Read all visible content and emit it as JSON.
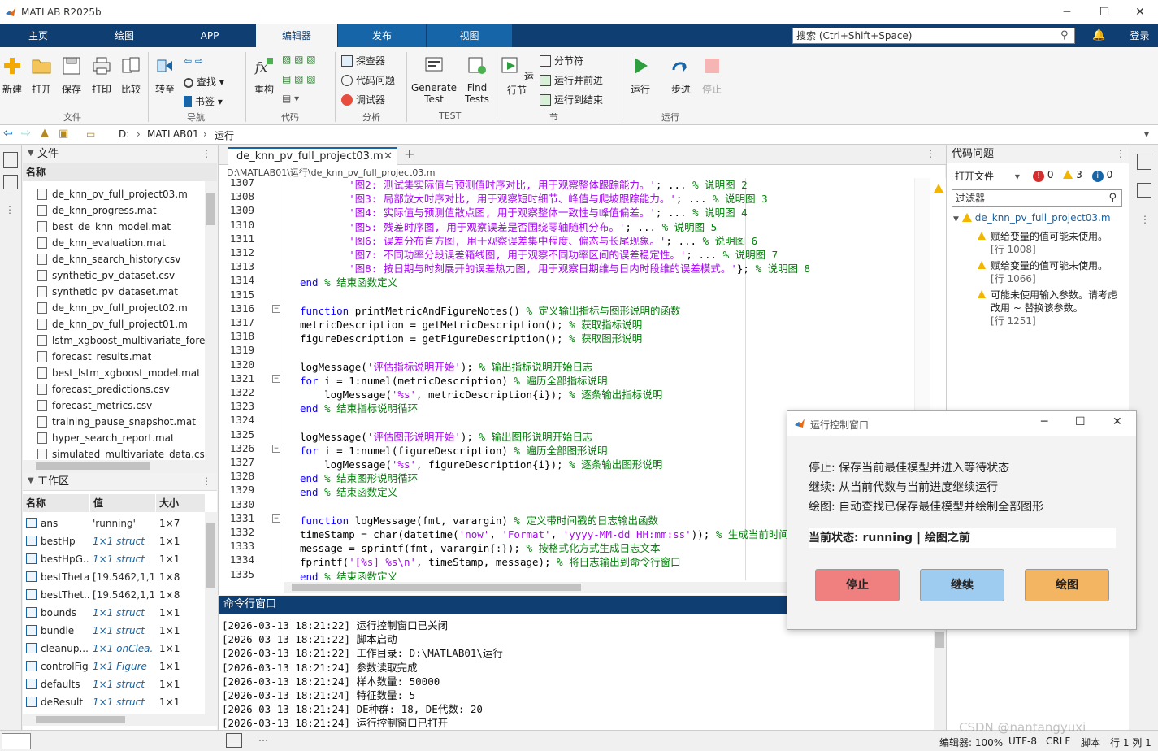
{
  "window": {
    "title": "MATLAB R2025b"
  },
  "tabs": [
    "主页",
    "绘图",
    "APP",
    "编辑器",
    "发布",
    "视图"
  ],
  "search": {
    "placeholder": "搜索 (Ctrl+Shift+Space)"
  },
  "login": "登录",
  "ribbon": {
    "file": {
      "new": "新建",
      "open": "打开",
      "save": "保存",
      "print": "打印",
      "compare": "比较",
      "group": "文件"
    },
    "nav": {
      "goto": "转至",
      "find": "查找",
      "bookmark": "书签",
      "group": "导航"
    },
    "code": {
      "refactor": "重构",
      "group": "代码"
    },
    "analyze": {
      "explorer": "探查器",
      "issues": "代码问题",
      "debugger": "调试器",
      "group": "分析"
    },
    "test": {
      "generate1": "Generate",
      "generate2": "Test",
      "find1": "Find",
      "find2": "Tests",
      "group": "TEST"
    },
    "section": {
      "runsection": "运行节",
      "sectionbreak": "分节符",
      "runadvance": "运行并前进",
      "runtoend": "运行到结束",
      "group": "节"
    },
    "run": {
      "run": "运行",
      "step": "步进",
      "stop": "停止",
      "group": "运行"
    }
  },
  "address": {
    "parts": [
      "D:",
      "MATLAB01",
      "运行"
    ]
  },
  "files": {
    "title": "文件",
    "col": "名称",
    "items": [
      "de_knn_pv_full_project03.m",
      "de_knn_progress.mat",
      "best_de_knn_model.mat",
      "de_knn_evaluation.mat",
      "de_knn_search_history.csv",
      "synthetic_pv_dataset.csv",
      "synthetic_pv_dataset.mat",
      "de_knn_pv_full_project02.m",
      "de_knn_pv_full_project01.m",
      "lstm_xgboost_multivariate_forecast",
      "forecast_results.mat",
      "best_lstm_xgboost_model.mat",
      "forecast_predictions.csv",
      "forecast_metrics.csv",
      "training_pause_snapshot.mat",
      "hyper_search_report.mat",
      "simulated_multivariate_data.csv"
    ]
  },
  "workspace": {
    "title": "工作区",
    "cols": [
      "名称",
      "值",
      "大小"
    ],
    "rows": [
      [
        "ans",
        "'running'",
        "1×7"
      ],
      [
        "bestHp",
        "1×1 struct",
        "1×1"
      ],
      [
        "bestHpG...",
        "1×1 struct",
        "1×1"
      ],
      [
        "bestTheta",
        "[19.5462,1,1,...",
        "1×8"
      ],
      [
        "bestThet...",
        "[19.5462,1,1,...",
        "1×8"
      ],
      [
        "bounds",
        "1×1 struct",
        "1×1"
      ],
      [
        "bundle",
        "1×1 struct",
        "1×1"
      ],
      [
        "cleanup...",
        "1×1 onClea...",
        "1×1"
      ],
      [
        "controlFig",
        "1×1 Figure",
        "1×1"
      ],
      [
        "defaults",
        "1×1 struct",
        "1×1"
      ],
      [
        "deResult",
        "1×1 struct",
        "1×1"
      ]
    ]
  },
  "editor": {
    "tab": "de_knn_pv_full_project03.m",
    "path": "D:\\MATLAB01\\运行\\de_knn_pv_full_project03.m",
    "lines": [
      {
        "n": "1307",
        "html": "        <span class=\"st\">'图2: 测试集实际值与预测值时序对比, 用于观察整体跟踪能力。'</span>; ... <span class=\"cm\">% 说明图 2</span>"
      },
      {
        "n": "1308",
        "html": "        <span class=\"st\">'图3: 局部放大时序对比, 用于观察短时细节、峰值与爬坡跟踪能力。'</span>; ... <span class=\"cm\">% 说明图 3</span>"
      },
      {
        "n": "1309",
        "html": "        <span class=\"st\">'图4: 实际值与预测值散点图, 用于观察整体一致性与峰值偏差。'</span>; ... <span class=\"cm\">% 说明图 4</span>"
      },
      {
        "n": "1310",
        "html": "        <span class=\"st\">'图5: 残差时序图, 用于观察误差是否围绕零轴随机分布。'</span>; ... <span class=\"cm\">% 说明图 5</span>"
      },
      {
        "n": "1311",
        "html": "        <span class=\"st\">'图6: 误差分布直方图, 用于观察误差集中程度、偏态与长尾现象。'</span>; ... <span class=\"cm\">% 说明图 6</span>"
      },
      {
        "n": "1312",
        "html": "        <span class=\"st\">'图7: 不同功率分段误差箱线图, 用于观察不同功率区间的误差稳定性。'</span>; ... <span class=\"cm\">% 说明图 7</span>"
      },
      {
        "n": "1313",
        "html": "        <span class=\"st\">'图8: 按日期与时刻展开的误差热力图, 用于观察日期维与日内时段维的误差模式。'</span>}; <span class=\"cm\">% 说明图 8</span>"
      },
      {
        "n": "1314",
        "html": "<span class=\"kw\">end</span> <span class=\"cm\">% 结束函数定义</span>"
      },
      {
        "n": "1315",
        "html": ""
      },
      {
        "n": "1316",
        "html": "<span class=\"kw\">function</span> printMetricAndFigureNotes() <span class=\"cm\">% 定义输出指标与图形说明的函数</span>",
        "fold": true
      },
      {
        "n": "1317",
        "html": "metricDescription = getMetricDescription(); <span class=\"cm\">% 获取指标说明</span>"
      },
      {
        "n": "1318",
        "html": "figureDescription = getFigureDescription(); <span class=\"cm\">% 获取图形说明</span>"
      },
      {
        "n": "1319",
        "html": ""
      },
      {
        "n": "1320",
        "html": "logMessage(<span class=\"st\">'评估指标说明开始'</span>); <span class=\"cm\">% 输出指标说明开始日志</span>"
      },
      {
        "n": "1321",
        "html": "<span class=\"kw\">for</span> i = 1:numel(metricDescription) <span class=\"cm\">% 遍历全部指标说明</span>",
        "fold": true
      },
      {
        "n": "1322",
        "html": "    logMessage(<span class=\"st\">'%s'</span>, metricDescription{i}); <span class=\"cm\">% 逐条输出指标说明</span>"
      },
      {
        "n": "1323",
        "html": "<span class=\"kw\">end</span> <span class=\"cm\">% 结束指标说明循环</span>"
      },
      {
        "n": "1324",
        "html": ""
      },
      {
        "n": "1325",
        "html": "logMessage(<span class=\"st\">'评估图形说明开始'</span>); <span class=\"cm\">% 输出图形说明开始日志</span>"
      },
      {
        "n": "1326",
        "html": "<span class=\"kw\">for</span> i = 1:numel(figureDescription) <span class=\"cm\">% 遍历全部图形说明</span>",
        "fold": true
      },
      {
        "n": "1327",
        "html": "    logMessage(<span class=\"st\">'%s'</span>, figureDescription{i}); <span class=\"cm\">% 逐条输出图形说明</span>"
      },
      {
        "n": "1328",
        "html": "<span class=\"kw\">end</span> <span class=\"cm\">% 结束图形说明循环</span>"
      },
      {
        "n": "1329",
        "html": "<span class=\"kw\">end</span> <span class=\"cm\">% 结束函数定义</span>"
      },
      {
        "n": "1330",
        "html": ""
      },
      {
        "n": "1331",
        "html": "<span class=\"kw\">function</span> logMessage(fmt, varargin) <span class=\"cm\">% 定义带时间戳的日志输出函数</span>",
        "fold": true
      },
      {
        "n": "1332",
        "html": "timeStamp = char(datetime(<span class=\"st\">'now'</span>, <span class=\"st\">'Format'</span>, <span class=\"st\">'yyyy-MM-dd HH:mm:ss'</span>)); <span class=\"cm\">% 生成当前时间</span>"
      },
      {
        "n": "1333",
        "html": "message = sprintf(fmt, varargin{:}); <span class=\"cm\">% 按格式化方式生成日志文本</span>"
      },
      {
        "n": "1334",
        "html": "fprintf(<span class=\"st\">'[%s] %s\\n'</span>, timeStamp, message); <span class=\"cm\">% 将日志输出到命令行窗口</span>"
      },
      {
        "n": "1335",
        "html": "<span class=\"kw\">end</span> <span class=\"cm\">% 结束函数定义</span>"
      }
    ]
  },
  "issues": {
    "title": "代码问题",
    "open_files": "打开文件",
    "counts": {
      "errors": "0",
      "warnings": "3",
      "info": "0"
    },
    "filter": "过滤器",
    "file": "de_knn_pv_full_project03.m",
    "items": [
      {
        "text": "赋给变量的值可能未使用。",
        "loc": "[行 1008]"
      },
      {
        "text": "赋给变量的值可能未使用。",
        "loc": "[行 1066]"
      },
      {
        "text": "可能未使用输入参数。请考虑改用 ~ 替换该参数。",
        "loc": "[行 1251]"
      }
    ]
  },
  "cmd": {
    "title": "命令行窗口",
    "lines": [
      "[2026-03-13 18:21:22] 运行控制窗口已关闭",
      "[2026-03-13 18:21:22] 脚本启动",
      "[2026-03-13 18:21:22] 工作目录: D:\\MATLAB01\\运行",
      "[2026-03-13 18:21:24] 参数读取完成",
      "[2026-03-13 18:21:24] 样本数量: 50000",
      "[2026-03-13 18:21:24] 特征数量: 5",
      "[2026-03-13 18:21:24] DE种群: 18, DE代数: 20",
      "[2026-03-13 18:21:24] 运行控制窗口已打开"
    ]
  },
  "dialog": {
    "title": "运行控制窗口",
    "lines": [
      "停止: 保存当前最佳模型并进入等待状态",
      "继续: 从当前代数与当前进度继续运行",
      "绘图: 自动查找已保存最佳模型并绘制全部图形"
    ],
    "status": "当前状态: running | 绘图之前",
    "buttons": {
      "stop": "停止",
      "continue": "继续",
      "plot": "绘图"
    },
    "colors": {
      "stop": "#f08080",
      "continue": "#9ecbf0",
      "plot": "#f4b562"
    }
  },
  "statusbar": {
    "zoom": "编辑器: 100%",
    "encoding": "UTF-8",
    "eol": "CRLF",
    "type": "脚本",
    "pos": "行 1 列 1"
  },
  "watermark": "CSDN @nantangyuxi"
}
